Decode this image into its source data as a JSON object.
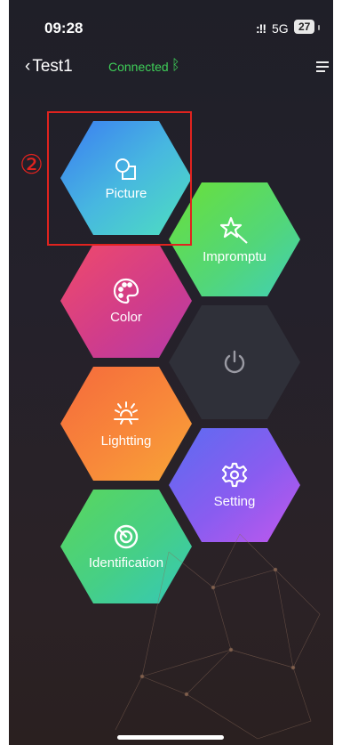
{
  "status_bar": {
    "time": "09:28",
    "signal": ":!!",
    "network": "5G",
    "battery": "27"
  },
  "nav": {
    "back_label": "Test1",
    "connection_status": "Connected",
    "bluetooth_icon": "bluetooth-icon",
    "menu_icon": "menu-icon"
  },
  "tiles": {
    "picture": {
      "label": "Picture",
      "icon": "picture-icon"
    },
    "impromptu": {
      "label": "Impromptu",
      "icon": "magic-wand-icon"
    },
    "color": {
      "label": "Color",
      "icon": "palette-icon"
    },
    "power": {
      "icon": "power-icon"
    },
    "lightting": {
      "label": "Lightting",
      "icon": "sun-icon"
    },
    "setting": {
      "label": "Setting",
      "icon": "gear-icon"
    },
    "identification": {
      "label": "Identification",
      "icon": "target-icon"
    }
  },
  "annotation": {
    "step_marker": "②"
  },
  "colors": {
    "connected_green": "#3ecf58",
    "annotation_red": "#e0231f"
  }
}
